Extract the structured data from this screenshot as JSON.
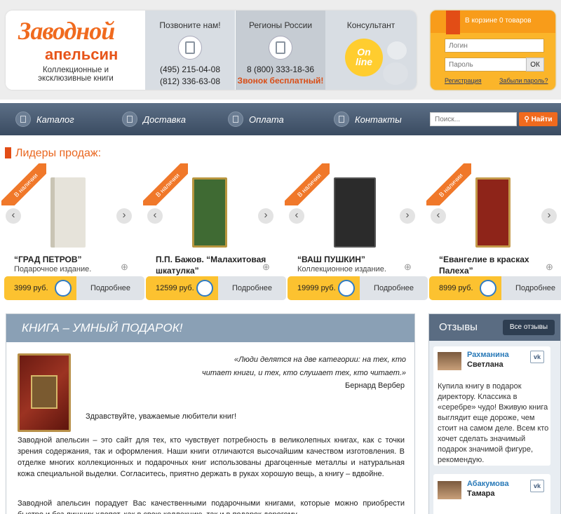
{
  "logo": {
    "word1": "Заводной",
    "word2": "апельсин",
    "tagline1": "Коллекционные и",
    "tagline2": "эксклюзивные книги"
  },
  "contacts": {
    "call": {
      "label": "Позвоните нам!",
      "phone1": "(495) 215-04-08",
      "phone2": "(812) 336-63-08"
    },
    "regions": {
      "label": "Регионы России",
      "phone": "8 (800) 333-18-36",
      "free": "Звонок бесплатный!"
    },
    "consultant": {
      "label": "Консультант",
      "online1": "On",
      "online2": "line"
    }
  },
  "cart": {
    "status": "В корзине 0 товаров",
    "login_placeholder": "Логин",
    "password_placeholder": "Пароль",
    "ok": "ОК",
    "register": "Регистрация",
    "forgot": "Забыли пароль?"
  },
  "nav": [
    {
      "label": "Каталог",
      "icon": "catalog-icon"
    },
    {
      "label": "Доставка",
      "icon": "delivery-icon"
    },
    {
      "label": "Оплата",
      "icon": "payment-icon"
    },
    {
      "label": "Контакты",
      "icon": "phone-icon"
    }
  ],
  "search": {
    "placeholder": "Поиск...",
    "button": "Найти"
  },
  "leaders": {
    "title": "Лидеры продаж:",
    "badge": "В наличии",
    "more": "Подробнее",
    "items": [
      {
        "title": "“ГРАД ПЕТРОВ”",
        "subtitle": "Подарочное издание.",
        "price": "3999 руб.",
        "color": "#e6e3da"
      },
      {
        "title": "П.П. Бажов. “Малахитовая шкатулка”",
        "subtitle": "",
        "price": "12599 руб.",
        "color": "#3f6a33"
      },
      {
        "title": "“ВАШ ПУШКИН”",
        "subtitle": "Коллекционное издание.",
        "price": "19999 руб.",
        "color": "#2b2b2b"
      },
      {
        "title": "“Евангелие в красках Палеха”",
        "subtitle": "",
        "price": "8999 руб.",
        "color": "#8e2419"
      }
    ]
  },
  "main": {
    "heading": "КНИГА – УМНЫЙ ПОДАРОК!",
    "quote1": "«Люди делятся на две категории: на тех, кто",
    "quote2": "читает книги, и тех, кто слушает тех, кто читает.»",
    "author": "Бернард Вербер",
    "greeting": "Здравствуйте, уважаемые любители книг!",
    "p1": "Заводной апельсин – это сайт для тех, кто чувствует потребность в великолепных книгах, как с точки зрения содержания, так и оформления. Наши книги отличаются высочайшим качеством изготовления. В отделке многих коллекционных и подарочных книг использованы драгоценные металлы и натуральная кожа специальной выделки. Согласитесь, приятно держать в руках хорошую вещь, а книгу – вдвойне.",
    "p2": "Заводной апельсин порадует Вас качественными подарочными книгами, которые можно приобрести быстро и без лишних хлопот, как в свою коллекцию, так и в подарок дорогому"
  },
  "reviews": {
    "title": "Отзывы",
    "all": "Все отзывы",
    "items": [
      {
        "first": "Рахманина",
        "last": "Светлана",
        "text": "Купила книгу в подарок директору. Классика в «серебре» чудо! Вживую книга выглядит еще дороже, чем стоит на самом деле. Всем кто хочет сделать значимый подарок значимой фигуре, рекомендую."
      },
      {
        "first": "Абакумова",
        "last": "Тамара",
        "text": ""
      }
    ]
  }
}
